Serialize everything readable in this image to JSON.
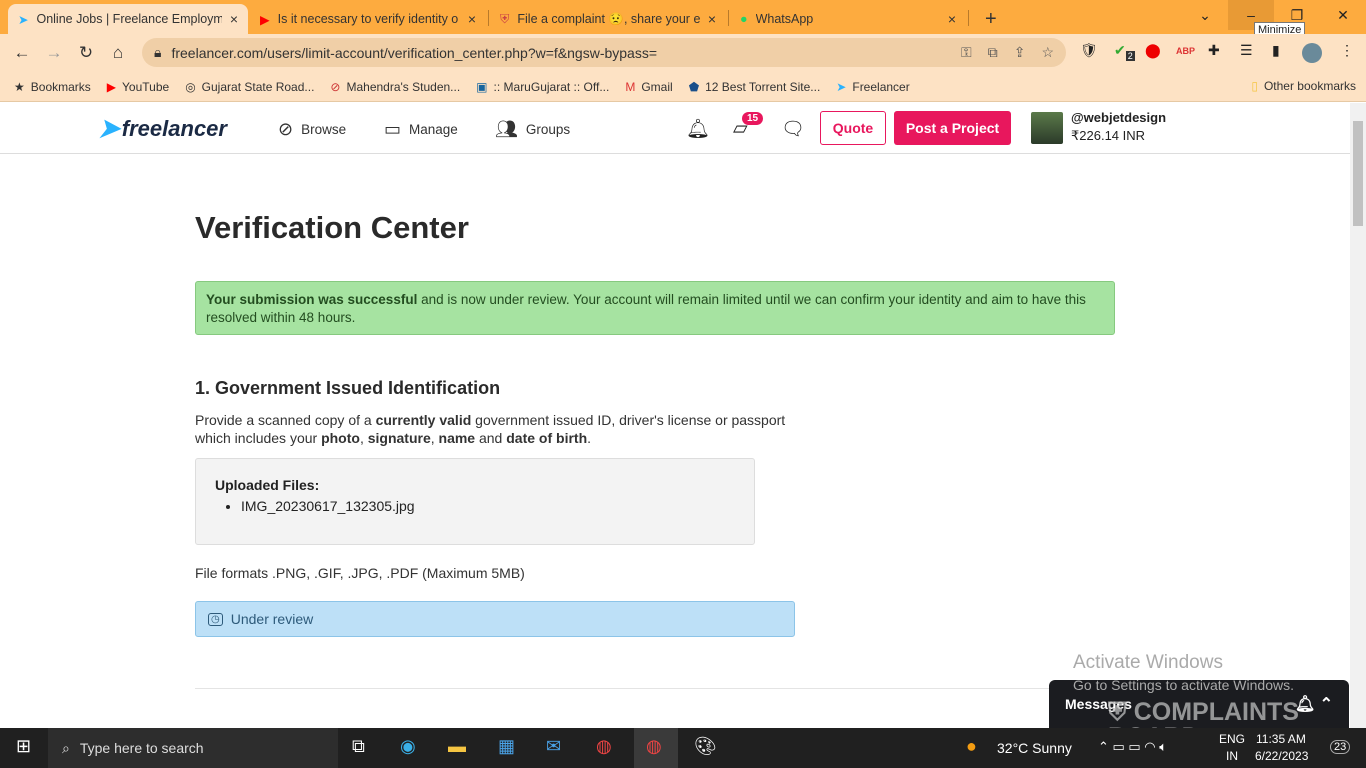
{
  "browser": {
    "tabs": [
      {
        "title": "Online Jobs | Freelance Employm",
        "active": true
      },
      {
        "title": "Is it necessary to verify identity o"
      },
      {
        "title": "File a complaint 😟, share your e"
      },
      {
        "title": "WhatsApp"
      }
    ],
    "tooltip": "Minimize",
    "url": "freelancer.com/users/limit-account/verification_center.php?w=f&ngsw-bypass=",
    "ext_badge": "2",
    "bookmarks": [
      "Bookmarks",
      "YouTube",
      "Gujarat State Road...",
      "Mahendra's Studen...",
      ":: MaruGujarat :: Off...",
      "Gmail",
      "12 Best Torrent Site...",
      "Freelancer"
    ],
    "other_bookmarks": "Other bookmarks"
  },
  "header": {
    "logo": "freelancer",
    "nav": [
      "Browse",
      "Manage",
      "Groups"
    ],
    "inbox_count": "15",
    "quote": "Quote",
    "post": "Post a Project",
    "username": "@webjetdesign",
    "balance": "₹226.14 INR"
  },
  "main": {
    "title": "Verification Center",
    "alert_bold": "Your submission was successful",
    "alert_rest": " and is now under review. Your account will remain limited until we can confirm your identity and aim to have this resolved within 48 hours.",
    "section_title": "1. Government Issued Identification",
    "desc": [
      "Provide a scanned copy of a ",
      "currently valid",
      " government issued ID, driver's license or passport which includes your ",
      "photo",
      ", ",
      "signature",
      ", ",
      "name",
      " and ",
      "date of birth",
      "."
    ],
    "uploaded_label": "Uploaded Files:",
    "files": [
      "IMG_20230617_132305.jpg"
    ],
    "formats": "File formats .PNG, .GIF, .JPG, .PDF (Maximum 5MB)",
    "status": "Under review"
  },
  "overlay": {
    "activate_title": "Activate Windows",
    "activate_sub": "Go to Settings to activate Windows.",
    "messages": "Messages",
    "watermark": "COMPLAINTS BOARD"
  },
  "taskbar": {
    "search": "Type here to search",
    "weather": "32°C  Sunny",
    "lang1": "ENG",
    "lang2": "IN",
    "time": "11:35 AM",
    "date": "6/22/2023",
    "notif": "23"
  }
}
